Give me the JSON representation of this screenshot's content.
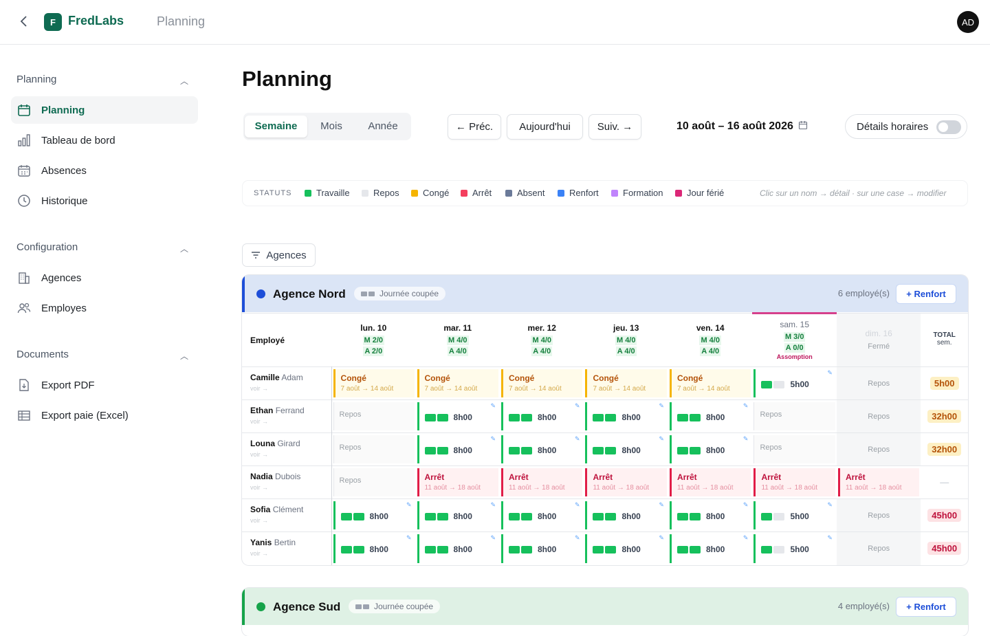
{
  "header": {
    "brand_letter": "F",
    "brand": "FredLabs",
    "crumb": "Planning",
    "avatar": "AD"
  },
  "sidebar": {
    "sections": [
      {
        "title": "Planning",
        "items": [
          {
            "label": "Planning",
            "active": true
          },
          {
            "label": "Tableau de bord"
          },
          {
            "label": "Absences"
          },
          {
            "label": "Historique"
          }
        ]
      },
      {
        "title": "Configuration",
        "items": [
          {
            "label": "Agences"
          },
          {
            "label": "Employes"
          }
        ]
      },
      {
        "title": "Documents",
        "items": [
          {
            "label": "Export PDF"
          },
          {
            "label": "Export paie (Excel)"
          }
        ]
      }
    ]
  },
  "page": {
    "title": "Planning"
  },
  "views": {
    "week": "Semaine",
    "month": "Mois",
    "year": "Année"
  },
  "nav": {
    "prev": "← Préc.",
    "today": "Aujourd'hui",
    "next": "Suiv. →",
    "range": "10 août – 16 août 2026",
    "details": "Détails horaires"
  },
  "legend": {
    "label": "STATUTS",
    "items": [
      {
        "label": "Travaille",
        "color": "#16c05c"
      },
      {
        "label": "Repos",
        "color": "#e5e7eb"
      },
      {
        "label": "Congé",
        "color": "#f5b400"
      },
      {
        "label": "Arrêt",
        "color": "#f43f5e"
      },
      {
        "label": "Absent",
        "color": "#6b7a99"
      },
      {
        "label": "Renfort",
        "color": "#3b82f6"
      },
      {
        "label": "Formation",
        "color": "#c084fc"
      },
      {
        "label": "Jour férié",
        "color": "#db2777"
      }
    ],
    "hint": "Clic sur un nom → détail · sur une case → modifier"
  },
  "filter": "Agences",
  "agencies": [
    {
      "name": "Agence Nord",
      "chip": "Journée coupée",
      "count": "6 employé(s)",
      "renfort": "+ Renfort",
      "accent": "#1d4ed8",
      "bg": "#dbe5f6",
      "columns": {
        "employee": "Employé",
        "total": "TOTAL",
        "total_sub": "sem.",
        "days": [
          {
            "label": "lun. 10",
            "m": "M 2/0",
            "a": "A 2/0"
          },
          {
            "label": "mar. 11",
            "m": "M 4/0",
            "a": "A 4/0"
          },
          {
            "label": "mer. 12",
            "m": "M 4/0",
            "a": "A 4/0"
          },
          {
            "label": "jeu. 13",
            "m": "M 4/0",
            "a": "A 4/0"
          },
          {
            "label": "ven. 14",
            "m": "M 4/0",
            "a": "A 4/0"
          },
          {
            "label": "sam. 15",
            "m": "M 3/0",
            "a": "A 0/0",
            "feast": "Assomption"
          },
          {
            "label": "dim. 16",
            "closed": "Fermé"
          }
        ]
      },
      "rows": [
        {
          "first": "Camille",
          "last": "Adam",
          "link": "voir →",
          "cells": [
            {
              "t": "conge",
              "label": "Congé",
              "sub": "7 août → 14 août"
            },
            {
              "t": "conge",
              "label": "Congé",
              "sub": "7 août → 14 août"
            },
            {
              "t": "conge",
              "label": "Congé",
              "sub": "7 août → 14 août"
            },
            {
              "t": "conge",
              "label": "Congé",
              "sub": "7 août → 14 août"
            },
            {
              "t": "conge",
              "label": "Congé",
              "sub": "7 août → 14 août"
            },
            {
              "t": "work",
              "half": true,
              "hours": "5h00"
            },
            {
              "t": "sun",
              "label": "Repos"
            }
          ],
          "total": "5h00",
          "total_bg": "#fdf0c4",
          "total_fg": "#b45309"
        },
        {
          "first": "Ethan",
          "last": "Ferrand",
          "link": "voir →",
          "cells": [
            {
              "t": "repos",
              "label": "Repos"
            },
            {
              "t": "work",
              "hours": "8h00"
            },
            {
              "t": "work",
              "hours": "8h00"
            },
            {
              "t": "work",
              "hours": "8h00"
            },
            {
              "t": "work",
              "hours": "8h00"
            },
            {
              "t": "repos",
              "label": "Repos"
            },
            {
              "t": "sun",
              "label": "Repos"
            }
          ],
          "total": "32h00",
          "total_bg": "#fdf0c4",
          "total_fg": "#b45309"
        },
        {
          "first": "Louna",
          "last": "Girard",
          "link": "voir →",
          "cells": [
            {
              "t": "repos",
              "label": "Repos"
            },
            {
              "t": "work",
              "hours": "8h00"
            },
            {
              "t": "work",
              "hours": "8h00"
            },
            {
              "t": "work",
              "hours": "8h00"
            },
            {
              "t": "work",
              "hours": "8h00"
            },
            {
              "t": "repos",
              "label": "Repos"
            },
            {
              "t": "sun",
              "label": "Repos"
            }
          ],
          "total": "32h00",
          "total_bg": "#fdf0c4",
          "total_fg": "#b45309"
        },
        {
          "first": "Nadia",
          "last": "Dubois",
          "link": "voir →",
          "cells": [
            {
              "t": "repos",
              "label": "Repos"
            },
            {
              "t": "arret",
              "label": "Arrêt",
              "sub": "11 août → 18 août"
            },
            {
              "t": "arret",
              "label": "Arrêt",
              "sub": "11 août → 18 août"
            },
            {
              "t": "arret",
              "label": "Arrêt",
              "sub": "11 août → 18 août"
            },
            {
              "t": "arret",
              "label": "Arrêt",
              "sub": "11 août → 18 août"
            },
            {
              "t": "arret",
              "label": "Arrêt",
              "sub": "11 août → 18 août"
            },
            {
              "t": "arret",
              "label": "Arrêt",
              "sub": "11 août → 18 août"
            }
          ],
          "total": "—",
          "total_bg": "transparent",
          "total_fg": "#d1d5db"
        },
        {
          "first": "Sofia",
          "last": "Clément",
          "link": "voir →",
          "cells": [
            {
              "t": "work",
              "hours": "8h00"
            },
            {
              "t": "work",
              "hours": "8h00"
            },
            {
              "t": "work",
              "hours": "8h00"
            },
            {
              "t": "work",
              "hours": "8h00"
            },
            {
              "t": "work",
              "hours": "8h00"
            },
            {
              "t": "work",
              "half": true,
              "hours": "5h00"
            },
            {
              "t": "sun",
              "label": "Repos"
            }
          ],
          "total": "45h00",
          "total_bg": "#fde2e4",
          "total_fg": "#be123c"
        },
        {
          "first": "Yanis",
          "last": "Bertin",
          "link": "voir →",
          "cells": [
            {
              "t": "work",
              "hours": "8h00"
            },
            {
              "t": "work",
              "hours": "8h00"
            },
            {
              "t": "work",
              "hours": "8h00"
            },
            {
              "t": "work",
              "hours": "8h00"
            },
            {
              "t": "work",
              "hours": "8h00"
            },
            {
              "t": "work",
              "half": true,
              "hours": "5h00"
            },
            {
              "t": "sun",
              "label": "Repos"
            }
          ],
          "total": "45h00",
          "total_bg": "#fde2e4",
          "total_fg": "#be123c"
        }
      ]
    },
    {
      "name": "Agence Sud",
      "chip": "Journée coupée",
      "count": "4 employé(s)",
      "renfort": "+ Renfort",
      "accent": "#16a34a",
      "bg": "#dff1e5"
    }
  ]
}
